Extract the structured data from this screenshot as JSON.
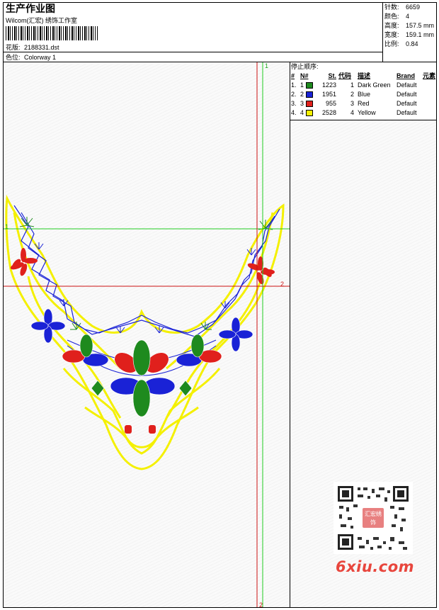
{
  "header": {
    "title": "生产作业图",
    "company": "Wilcom(汇宏) 绣饰工作室",
    "design_label": "花版:",
    "design_value": "2188331.dst",
    "colorway_label": "色位:",
    "colorway_value": "Colorway 1"
  },
  "stats": [
    {
      "label": "针数:",
      "value": "6659"
    },
    {
      "label": "颜色:",
      "value": "4"
    },
    {
      "label": "高度:",
      "value": "157.5 mm"
    },
    {
      "label": "宽度:",
      "value": "159.1 mm"
    },
    {
      "label": "比例:",
      "value": "0.84"
    }
  ],
  "stop_sequence": {
    "title": "停止顺序:",
    "headers": [
      "#",
      "N#",
      "St.",
      "代码",
      "描述",
      "Brand",
      "元素"
    ],
    "rows": [
      {
        "idx": "1.",
        "n": "1",
        "color": "#1e8a1e",
        "st": "1223",
        "code": "1",
        "desc": "Dark Green",
        "brand": "Default"
      },
      {
        "idx": "2.",
        "n": "2",
        "color": "#1a22d6",
        "st": "1951",
        "code": "2",
        "desc": "Blue",
        "brand": "Default"
      },
      {
        "idx": "3.",
        "n": "3",
        "color": "#e0201c",
        "st": "955",
        "code": "3",
        "desc": "Red",
        "brand": "Default"
      },
      {
        "idx": "4.",
        "n": "4",
        "color": "#f4f000",
        "st": "2528",
        "code": "4",
        "desc": "Yellow",
        "brand": "Default"
      }
    ]
  },
  "guides": {
    "green_top": "1",
    "green_left": "1",
    "red_right": "2",
    "red_bottom": "2"
  },
  "watermark": {
    "text": "6xiu.com",
    "stamp": "汇宏绣饰"
  },
  "colors": {
    "dark_green": "#1e8a1e",
    "blue": "#1a22d6",
    "red": "#e0201c",
    "yellow": "#f4f000",
    "guide_green": "#22cc22",
    "guide_red": "#cc1111"
  }
}
